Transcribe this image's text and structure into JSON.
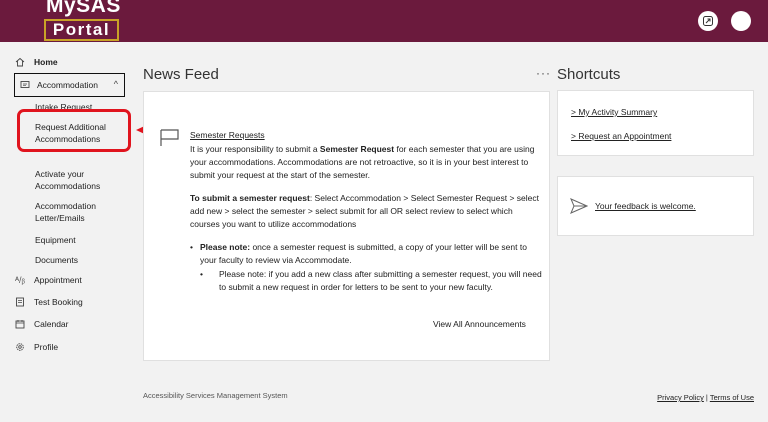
{
  "header": {
    "logo_top": "MySAS",
    "logo_bottom": "Portal",
    "bg_color": "#6b1a3d",
    "accent_color": "#c9a227"
  },
  "sidebar": {
    "home": "Home",
    "accommodation": "Accommodation",
    "sub_items": [
      "Intake Request",
      "Request Additional Accommodations",
      "Activate your Accommodations",
      "Accommodation Letter/Emails",
      "Equipment",
      "Documents"
    ],
    "appointment": "Appointment",
    "test_booking": "Test Booking",
    "calendar": "Calendar",
    "profile": "Profile"
  },
  "news": {
    "section_title": "News Feed",
    "more": "···",
    "item_title": "Semester Requests",
    "p1_a": "It is your responsibility to submit a ",
    "p1_bold": "Semester Request",
    "p1_b": " for each semester that you are using your accommodations. Accommodations are not retroactive, so it is in your best interest to submit your request at the start of the semester.",
    "p2_bold": "To submit a semester request",
    "p2_text": ":  Select Accommodation > Select Semester Request > select add new > select the semester > select submit for all OR select review to select which courses you want to utilize accommodations",
    "note_bold": "Please note:",
    "note_text": " once a semester request is submitted, a copy of your letter will be sent to your faculty to review via Accommodate.",
    "note2_text": "Please note: if you add a new class after submitting a semester request, you will need to submit a new request in order for letters to be sent to your new faculty.",
    "view_all": "View All Announcements"
  },
  "shortcuts": {
    "section_title": "Shortcuts",
    "link1": "> My Activity Summary",
    "link2": "> Request an Appointment",
    "feedback": "Your feedback is welcome."
  },
  "footer": {
    "left": "Accessibility Services Management System",
    "privacy": "Privacy Policy",
    "sep": " | ",
    "terms": "Terms of Use"
  },
  "highlight_color": "#e0141e"
}
